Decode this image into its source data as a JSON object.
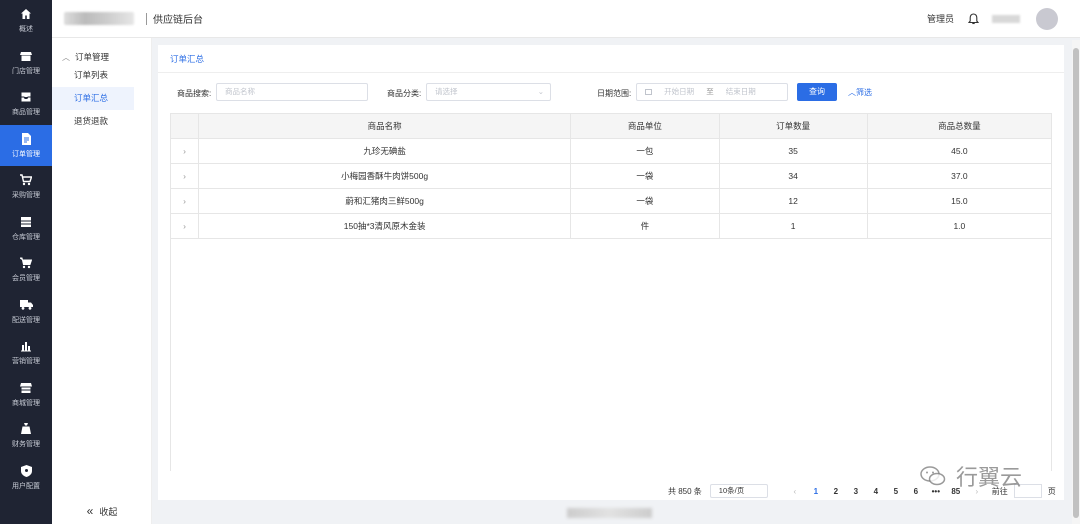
{
  "sidebar": {
    "items": [
      {
        "label": "概述",
        "icon": "home-icon",
        "active": false
      },
      {
        "label": "门店管理",
        "icon": "store-icon",
        "active": false
      },
      {
        "label": "商品管理",
        "icon": "inbox-icon",
        "active": false
      },
      {
        "label": "订单管理",
        "icon": "document-icon",
        "active": true
      },
      {
        "label": "采购管理",
        "icon": "cart-icon",
        "active": false
      },
      {
        "label": "仓库管理",
        "icon": "warehouse-icon",
        "active": false
      },
      {
        "label": "会员管理",
        "icon": "cart-icon",
        "active": false
      },
      {
        "label": "配送管理",
        "icon": "truck-icon",
        "active": false
      },
      {
        "label": "营销管理",
        "icon": "bar-chart-icon",
        "active": false
      },
      {
        "label": "商城管理",
        "icon": "shop-icon",
        "active": false
      },
      {
        "label": "财务管理",
        "icon": "money-bag-icon",
        "active": false
      },
      {
        "label": "用户配置",
        "icon": "shield-icon",
        "active": false
      }
    ]
  },
  "header": {
    "app_title": "供应链后台",
    "user_role": "管理员"
  },
  "subnav": {
    "group_label": "订单管理",
    "items": [
      "订单列表",
      "订单汇总",
      "退货退款"
    ],
    "collapse_label": "收起"
  },
  "card": {
    "title": "订单汇总"
  },
  "filters": {
    "search_label": "商品搜索:",
    "search_placeholder": "商品名称",
    "category_label": "商品分类:",
    "category_placeholder": "请选择",
    "date_label": "日期范围:",
    "date_start_placeholder": "开始日期",
    "date_separator": "至",
    "date_end_placeholder": "结束日期",
    "query_button": "查询",
    "filter_link": "筛选"
  },
  "table": {
    "columns": [
      "商品名称",
      "商品单位",
      "订单数量",
      "商品总数量"
    ],
    "rows": [
      [
        "九珍无碘盐",
        "一包",
        "35",
        "45.0"
      ],
      [
        "小梅园香酥牛肉饼500g",
        "一袋",
        "34",
        "37.0"
      ],
      [
        "蔚和汇猪肉三鲜500g",
        "一袋",
        "12",
        "15.0"
      ],
      [
        "150抽*3清风原木金装",
        "件",
        "1",
        "1.0"
      ]
    ]
  },
  "pagination": {
    "total_text": "共 850 条",
    "page_size": "10条/页",
    "pages": [
      "1",
      "2",
      "3",
      "4",
      "5",
      "6"
    ],
    "current_page": "1",
    "ellipsis": "•••",
    "last_page": "85",
    "goto_label": "前往",
    "goto_suffix": "页"
  },
  "watermark": {
    "text": "行翼云"
  },
  "colors": {
    "primary": "#2b6de5",
    "sidebar_bg": "#1f2433"
  }
}
